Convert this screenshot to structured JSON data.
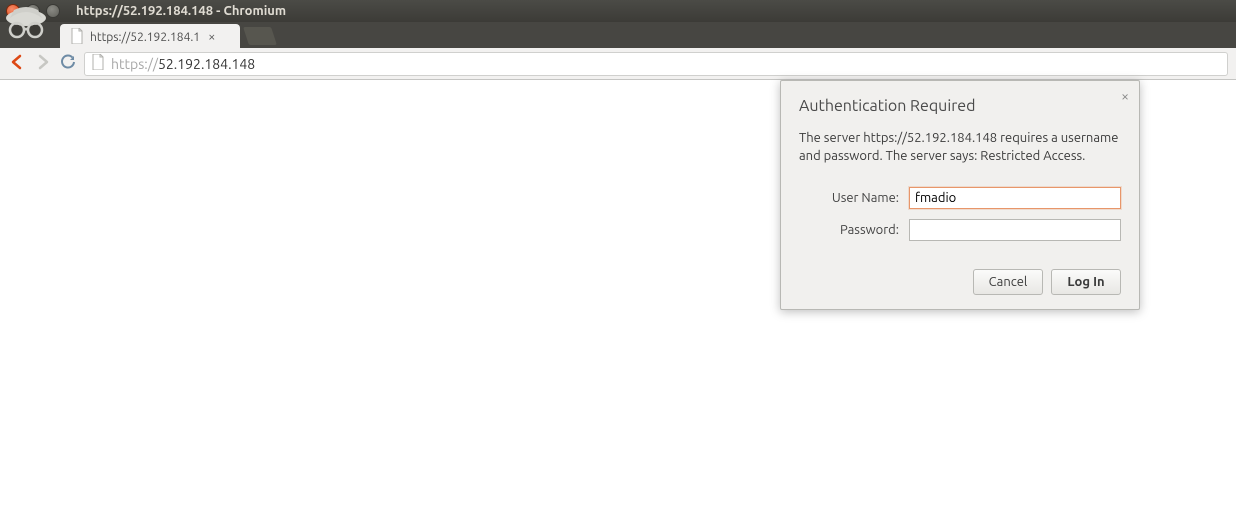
{
  "window": {
    "title": "https://52.192.184.148 - Chromium"
  },
  "tab": {
    "label": "https://52.192.184.1"
  },
  "omnibox": {
    "scheme": "https://",
    "host": "52.192.184.148"
  },
  "auth": {
    "title": "Authentication Required",
    "message": "The server https://52.192.184.148 requires a username and password. The server says: Restricted Access.",
    "username_label": "User Name:",
    "password_label": "Password:",
    "username_value": "fmadio",
    "password_value": "",
    "cancel_label": "Cancel",
    "login_label": "Log In",
    "close_glyph": "×"
  }
}
